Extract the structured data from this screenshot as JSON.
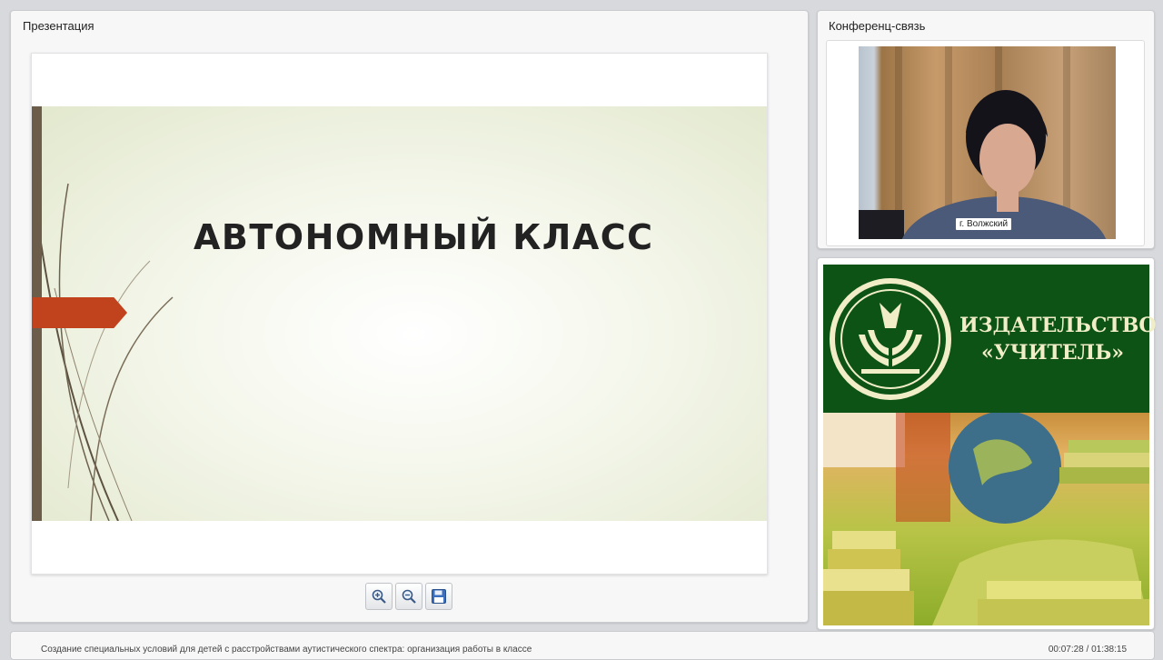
{
  "presentation": {
    "panel_title": "Презентация",
    "slide_title": "АВТОНОМНЫЙ КЛАСС",
    "toolbar": {
      "zoom_in_icon": "zoom-in-icon",
      "zoom_out_icon": "zoom-out-icon",
      "save_icon": "floppy-disk-icon"
    }
  },
  "conference": {
    "panel_title": "Конференц-связь",
    "video_label": "г. Волжский"
  },
  "ad": {
    "line1": "ИЗДАТЕЛЬСТВО",
    "line2": "«УЧИТЕЛЬ»"
  },
  "footer": {
    "title": "Создание специальных условий для детей с расстройствами аутистического спектра: организация работы в классе",
    "time": "00:07:28 / 01:38:15"
  },
  "colors": {
    "slide_accent_bar": "#6b5d49",
    "slide_arrow": "#c0431d",
    "ad_green": "#0d5316",
    "ad_text": "#f1eec7"
  }
}
